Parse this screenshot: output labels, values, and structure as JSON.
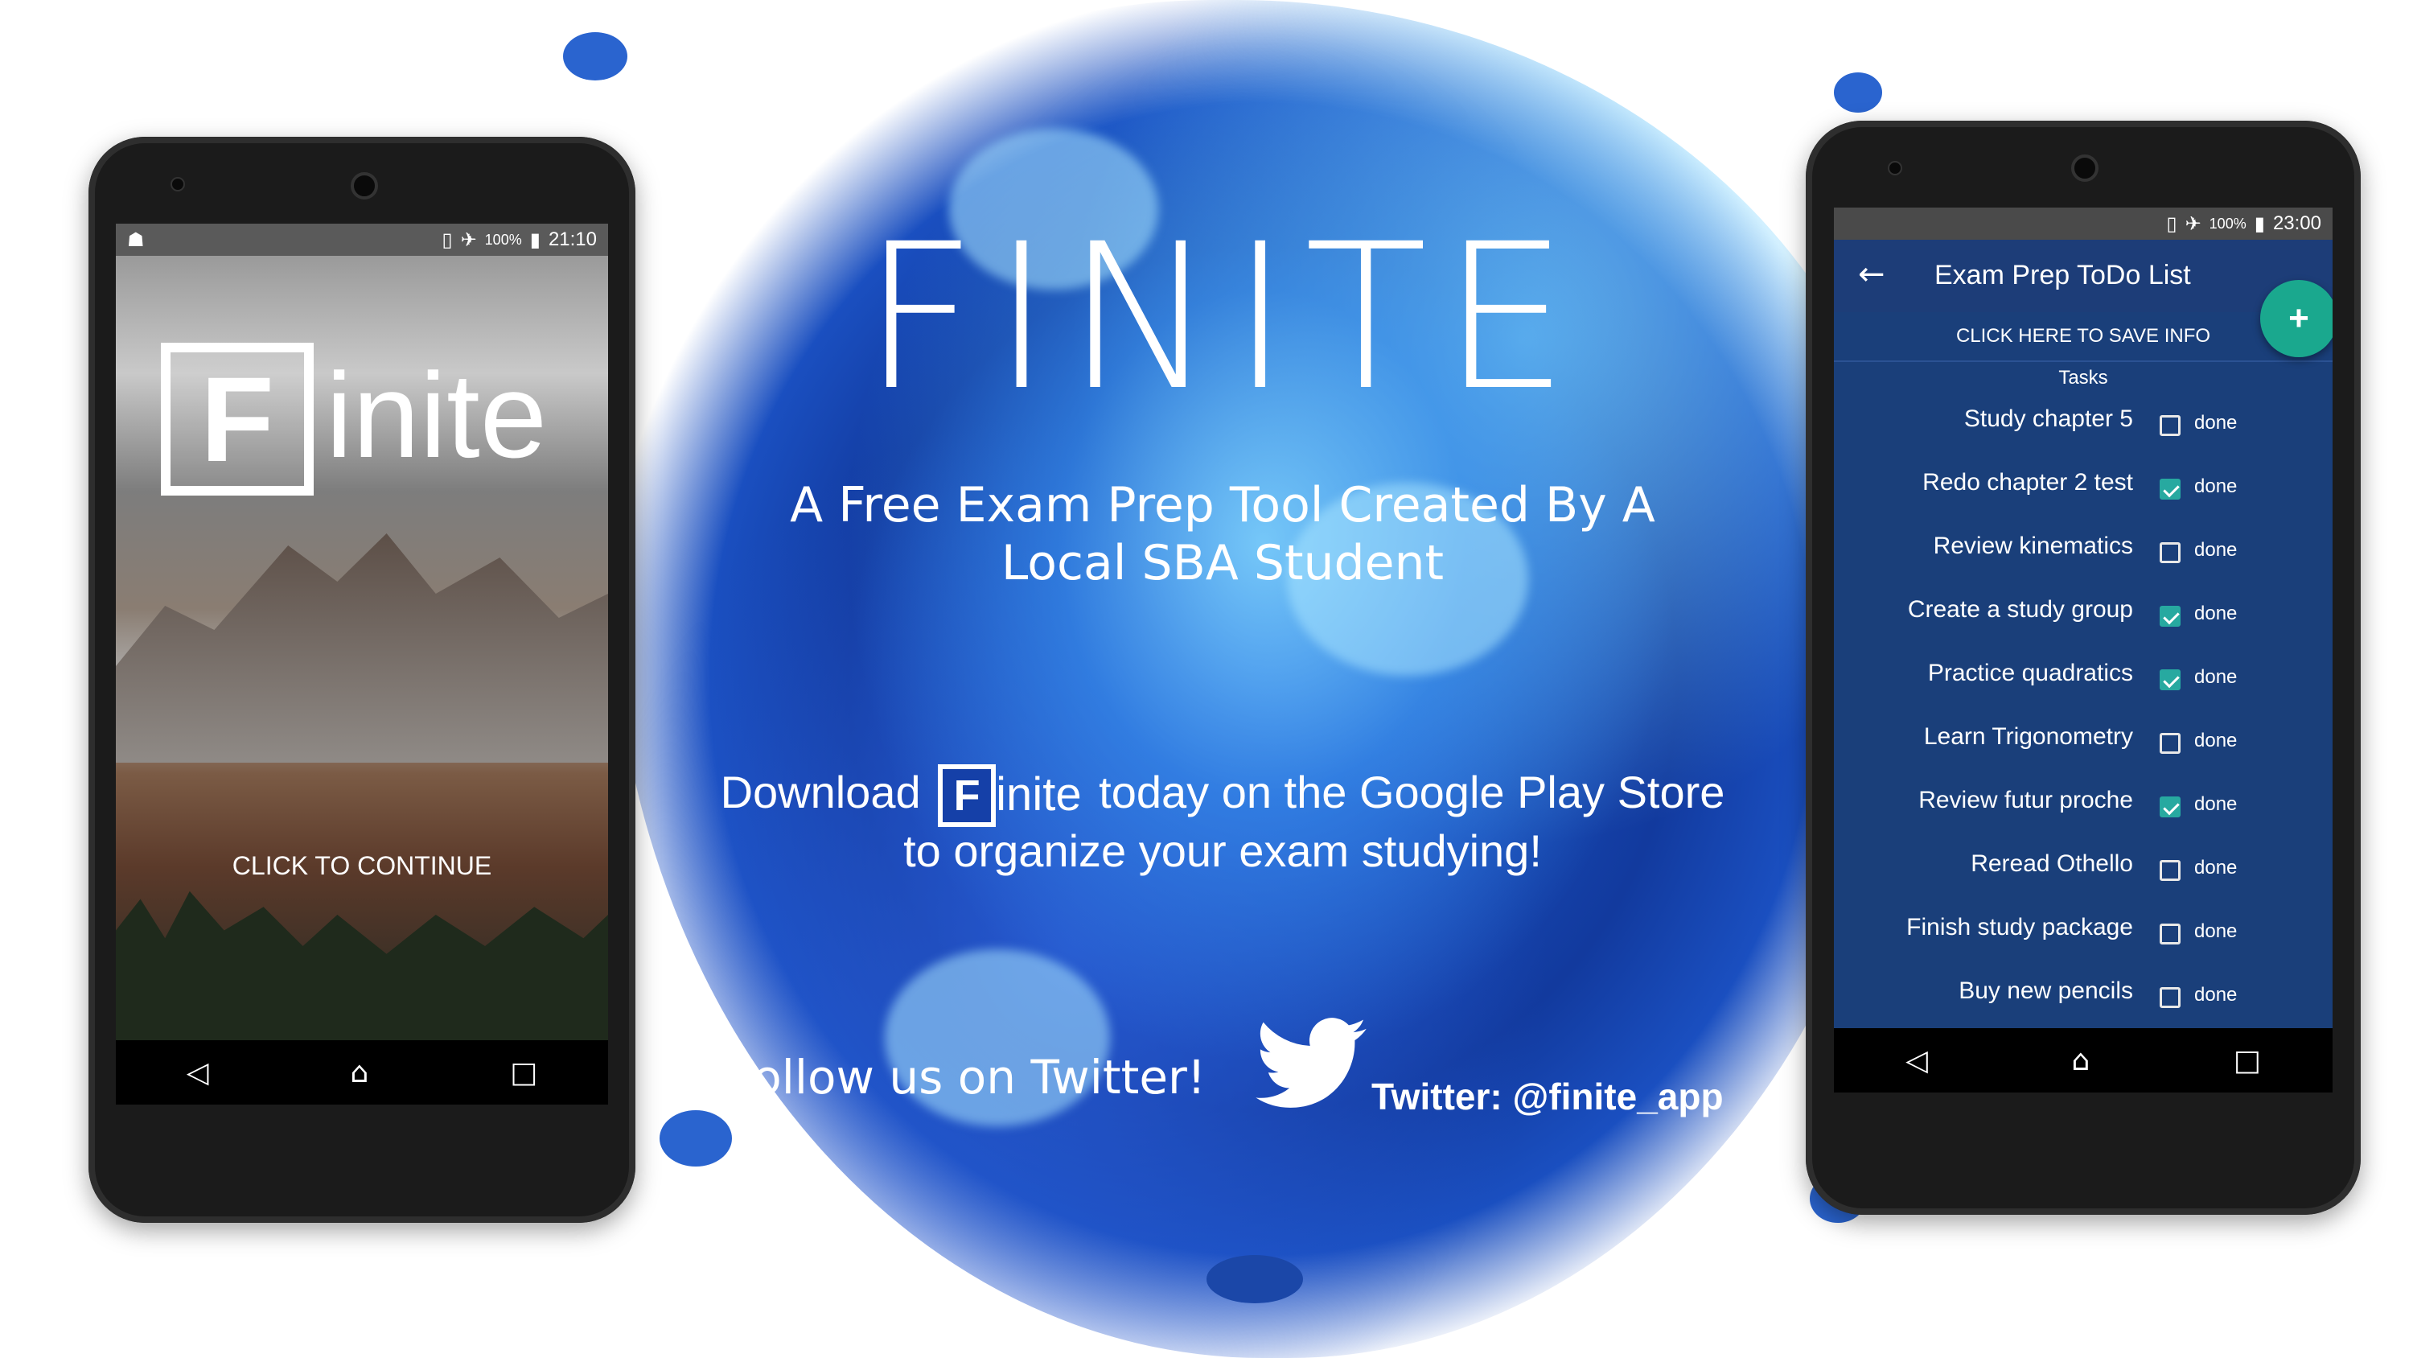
{
  "poster": {
    "title": "FINITE",
    "subtitle_line1": "A Free Exam Prep Tool Created By A",
    "subtitle_line2": "Local SBA Student",
    "download_prefix": "Download",
    "download_logo_letter": "F",
    "download_logo_rest": "inite",
    "download_suffix": "today on the Google Play Store",
    "download_line2": "to organize your exam studying!",
    "follow_text": "Follow us on Twitter!",
    "twitter_handle": "Twitter: @finite_app"
  },
  "left_phone": {
    "status": {
      "battery": "100%",
      "time": "21:10"
    },
    "logo_letter": "F",
    "logo_rest": "inite",
    "continue_label": "CLICK TO CONTINUE"
  },
  "right_phone": {
    "status": {
      "battery": "100%",
      "time": "23:00"
    },
    "app_title": "Exam Prep ToDo List",
    "save_label": "CLICK HERE TO SAVE INFO",
    "tasks_header": "Tasks",
    "fab_label": "+",
    "done_label": "done",
    "tasks": [
      {
        "label": "Study chapter 5",
        "checked": false
      },
      {
        "label": "Redo chapter 2 test",
        "checked": true
      },
      {
        "label": "Review kinematics",
        "checked": false
      },
      {
        "label": "Create a study group",
        "checked": true
      },
      {
        "label": "Practice quadratics",
        "checked": true
      },
      {
        "label": "Learn Trigonometry",
        "checked": false
      },
      {
        "label": "Review futur proche",
        "checked": true
      },
      {
        "label": "Reread Othello",
        "checked": false
      },
      {
        "label": "Finish study package",
        "checked": false
      },
      {
        "label": "Buy new pencils",
        "checked": false
      }
    ]
  },
  "icons": {
    "back": "arrow-left-icon",
    "home": "home-icon",
    "recents": "recents-icon",
    "twitter": "twitter-bird-icon"
  },
  "colors": {
    "todo_bg": "#1a3f7a",
    "todo_toolbar": "#1d3d78",
    "fab": "#1aa88e",
    "check": "#27a9a0",
    "splash_blue": "#1f5fd6"
  }
}
